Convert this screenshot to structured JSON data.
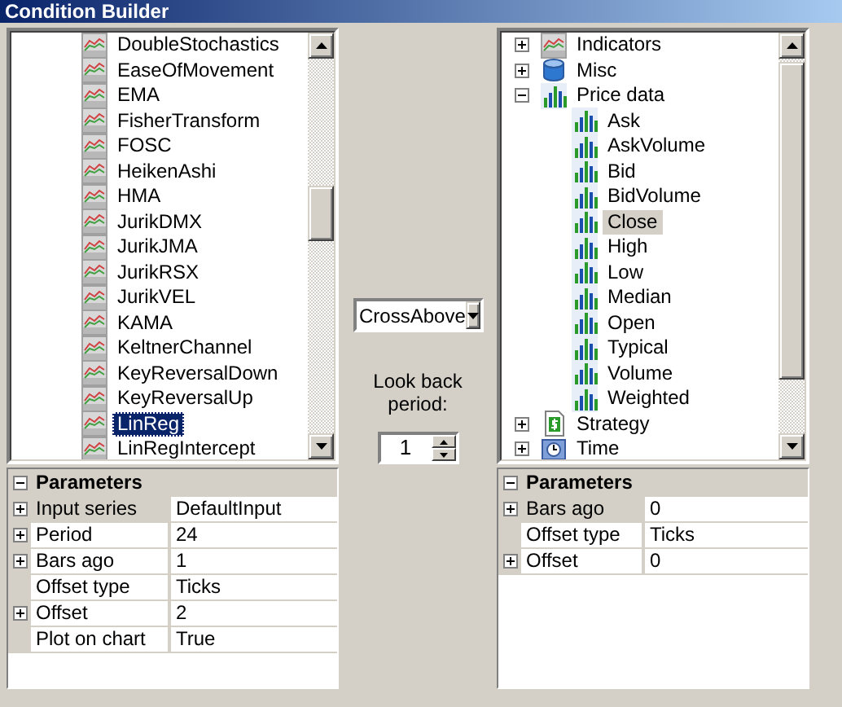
{
  "window": {
    "title": "Condition Builder"
  },
  "left_list": {
    "items": [
      {
        "label": "DoubleStochastics",
        "selected": false
      },
      {
        "label": "EaseOfMovement",
        "selected": false
      },
      {
        "label": "EMA",
        "selected": false
      },
      {
        "label": "FisherTransform",
        "selected": false
      },
      {
        "label": "FOSC",
        "selected": false
      },
      {
        "label": "HeikenAshi",
        "selected": false
      },
      {
        "label": "HMA",
        "selected": false
      },
      {
        "label": "JurikDMX",
        "selected": false
      },
      {
        "label": "JurikJMA",
        "selected": false
      },
      {
        "label": "JurikRSX",
        "selected": false
      },
      {
        "label": "JurikVEL",
        "selected": false
      },
      {
        "label": "KAMA",
        "selected": false
      },
      {
        "label": "KeltnerChannel",
        "selected": false
      },
      {
        "label": "KeyReversalDown",
        "selected": false
      },
      {
        "label": "KeyReversalUp",
        "selected": false
      },
      {
        "label": "LinReg",
        "selected": true
      },
      {
        "label": "LinRegIntercept",
        "selected": false
      }
    ]
  },
  "left_parameters": {
    "title": "Parameters",
    "expanded": true,
    "rows": [
      {
        "label": "Input series",
        "value": "DefaultInput",
        "expandable": true,
        "selected": true
      },
      {
        "label": "Period",
        "value": "24",
        "expandable": true,
        "selected": false
      },
      {
        "label": "Bars ago",
        "value": "1",
        "expandable": true,
        "selected": false
      },
      {
        "label": "Offset type",
        "value": "Ticks",
        "expandable": false,
        "selected": false
      },
      {
        "label": "Offset",
        "value": "2",
        "expandable": true,
        "selected": false
      },
      {
        "label": "Plot on chart",
        "value": "True",
        "expandable": false,
        "selected": false
      }
    ]
  },
  "operator": {
    "value": "CrossAbove"
  },
  "look_back": {
    "label": "Look back period:",
    "value": "1"
  },
  "right_tree": {
    "items": [
      {
        "label": "Indicators",
        "kind": "indicator",
        "expanded": false,
        "selected": false
      },
      {
        "label": "Misc",
        "kind": "misc",
        "expanded": false,
        "selected": false
      },
      {
        "label": "Price data",
        "kind": "price",
        "expanded": true,
        "selected": false,
        "children": [
          {
            "label": "Ask",
            "kind": "price",
            "selected": false
          },
          {
            "label": "AskVolume",
            "kind": "price",
            "selected": false
          },
          {
            "label": "Bid",
            "kind": "price",
            "selected": false
          },
          {
            "label": "BidVolume",
            "kind": "price",
            "selected": false
          },
          {
            "label": "Close",
            "kind": "price",
            "selected": true
          },
          {
            "label": "High",
            "kind": "price",
            "selected": false
          },
          {
            "label": "Low",
            "kind": "price",
            "selected": false
          },
          {
            "label": "Median",
            "kind": "price",
            "selected": false
          },
          {
            "label": "Open",
            "kind": "price",
            "selected": false
          },
          {
            "label": "Typical",
            "kind": "price",
            "selected": false
          },
          {
            "label": "Volume",
            "kind": "price",
            "selected": false
          },
          {
            "label": "Weighted",
            "kind": "price",
            "selected": false
          }
        ]
      },
      {
        "label": "Strategy",
        "kind": "strategy",
        "expanded": false,
        "selected": false
      },
      {
        "label": "Time",
        "kind": "time",
        "expanded": false,
        "selected": false
      }
    ]
  },
  "right_parameters": {
    "title": "Parameters",
    "expanded": true,
    "rows": [
      {
        "label": "Bars ago",
        "value": "0",
        "expandable": true,
        "selected": true
      },
      {
        "label": "Offset type",
        "value": "Ticks",
        "expandable": false,
        "selected": false
      },
      {
        "label": "Offset",
        "value": "0",
        "expandable": true,
        "selected": false
      }
    ]
  }
}
